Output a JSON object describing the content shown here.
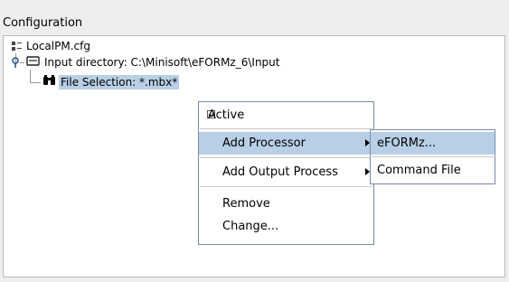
{
  "panel": {
    "title": "Configuration"
  },
  "tree": {
    "root": {
      "label": "LocalPM.cfg",
      "icon": "config-file-icon"
    },
    "input_dir": {
      "label": "Input directory: C:\\Minisoft\\eFORMz_6\\Input",
      "icon": "folder-icon"
    },
    "file_selection": {
      "label": "File Selection: *.mbx*",
      "icon": "binoculars-icon",
      "selected": true
    }
  },
  "context_menu": {
    "active_label": "Active",
    "active_checked": true,
    "add_processor_label": "Add Processor",
    "add_output_label": "Add Output Process",
    "remove_label": "Remove",
    "change_label": "Change..."
  },
  "submenu": {
    "eformz_label": "eFORMz...",
    "command_file_label": "Command File"
  },
  "colors": {
    "selection": "#b8cfe5",
    "menu_border": "#7a8aa8",
    "background": "#eeeeee"
  }
}
